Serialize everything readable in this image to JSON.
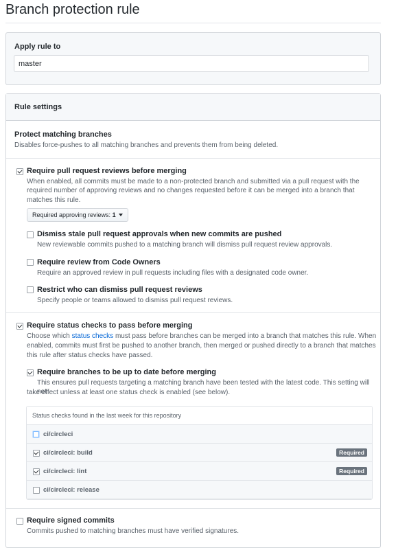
{
  "page": {
    "title": "Branch protection rule"
  },
  "apply": {
    "label": "Apply rule to",
    "value": "master"
  },
  "rules": {
    "header": "Rule settings",
    "protect": {
      "title": "Protect matching branches",
      "desc": "Disables force-pushes to all matching branches and prevents them from being deleted."
    },
    "reviews": {
      "checked": true,
      "title": "Require pull request reviews before merging",
      "desc_lines": [
        "When enabled, all commits must be made to a non-protected branch and submitted via a pull request with the",
        "required number of approving reviews and no changes requested before it can be merged into a branch that",
        "matches this rule."
      ],
      "approving_label": "Required approving reviews:",
      "approving_value": "1",
      "options": [
        {
          "checked": false,
          "title": "Dismiss stale pull request approvals when new commits are pushed",
          "desc": "New reviewable commits pushed to a matching branch will dismiss pull request review approvals."
        },
        {
          "checked": false,
          "title": "Require review from Code Owners",
          "desc": "Require an approved review in pull requests including files with a designated code owner."
        },
        {
          "checked": false,
          "title": "Restrict who can dismiss pull request reviews",
          "desc": "Specify people or teams allowed to dismiss pull request reviews."
        }
      ]
    },
    "status": {
      "checked": true,
      "title": "Require status checks to pass before merging",
      "desc_pre": "Choose which ",
      "desc_link": "status checks",
      "desc_post": " must pass before branches can be merged into a branch that matches this rule. When",
      "desc_lines": [
        "enabled, commits must first be pushed to another branch, then merged or pushed directly to a branch that matches",
        "this rule after status checks have passed."
      ],
      "uptodate": {
        "checked": true,
        "title": "Require branches to be up to date before merging",
        "desc_lines": [
          "This ensures pull requests targeting a matching branch have been tested with the latest code. This setting will not",
          "take effect unless at least one status check is enabled (see below)."
        ]
      },
      "checks_header": "Status checks found in the last week for this repository",
      "checks": [
        {
          "name": "ci/circleci",
          "checked": false,
          "badge": ""
        },
        {
          "name": "ci/circleci: build",
          "checked": true,
          "badge": "Required"
        },
        {
          "name": "ci/circleci: lint",
          "checked": true,
          "badge": "Required"
        },
        {
          "name": "ci/circleci: release",
          "checked": false,
          "badge": ""
        }
      ]
    },
    "signed": {
      "checked": false,
      "title": "Require signed commits",
      "desc": "Commits pushed to matching branches must have verified signatures."
    }
  }
}
